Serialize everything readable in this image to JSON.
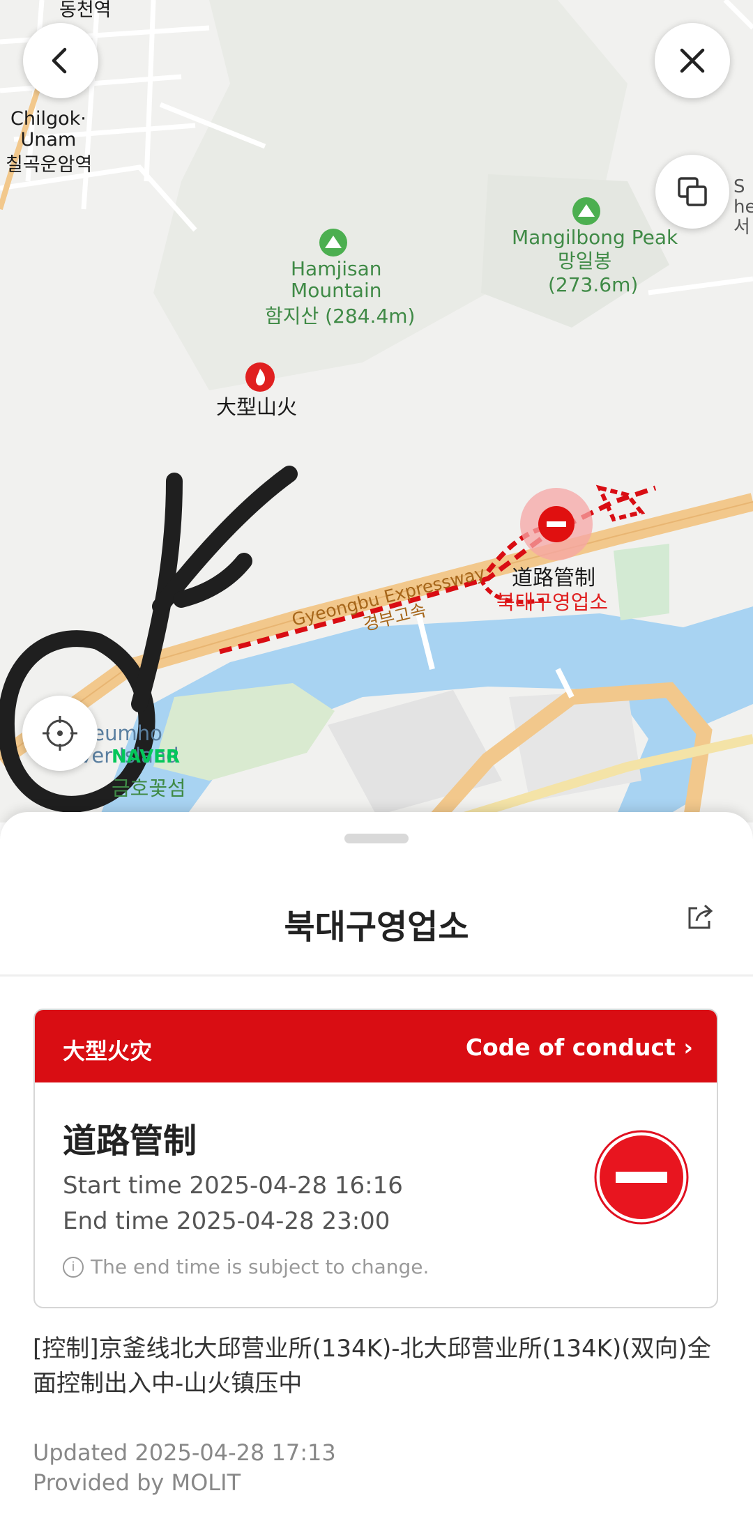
{
  "map": {
    "labels": {
      "station_ko": "동천역",
      "station2_en": "Chilgok·\nUnam",
      "station2_ko": "칠곡운암역",
      "mountain1_en": "Hamjisan\nMountain",
      "mountain1_ko": "함지산 (284.4m)",
      "mountain2_en": "Mangilbong Peak",
      "mountain2_ko": "망일봉",
      "mountain2_height": "(273.6m)",
      "fire": "大型山火",
      "expressway_en": "Gyeongbu Expressway",
      "expressway_ko": "경부고속",
      "road_control": "道路管制",
      "office_ko": "북대구영업소",
      "island_en": "Geumho\nRiver Island",
      "island_ko": "금호꽃섬",
      "naver": "NAVER",
      "edge_label": "S\nheo\n서"
    },
    "colors": {
      "alert": "#d90d13",
      "park": "#3f8a46",
      "road": "#f2c88c",
      "river": "#a8d3f2"
    }
  },
  "controls": {
    "back_icon": "chevron-left-icon",
    "close_icon": "close-icon",
    "layers_icon": "layers-icon",
    "locate_icon": "location-target-icon"
  },
  "sheet": {
    "title": "북대구영업소",
    "share_icon": "share-icon",
    "card": {
      "tag": "大型火灾",
      "code_of_conduct": "Code of conduct",
      "heading": "道路管制",
      "start": "Start time 2025-04-28 16:16",
      "end": "End time 2025-04-28 23:00",
      "note": "The end time is subject to change.",
      "status_icon": "no-entry-icon"
    },
    "description": "[控制]京釜线北大邱营业所(134K)-北大邱营业所(134K)(双向)全面控制出入中-山火镇压中",
    "updated": "Updated 2025-04-28 17:13",
    "provider": "Provided by MOLIT"
  }
}
